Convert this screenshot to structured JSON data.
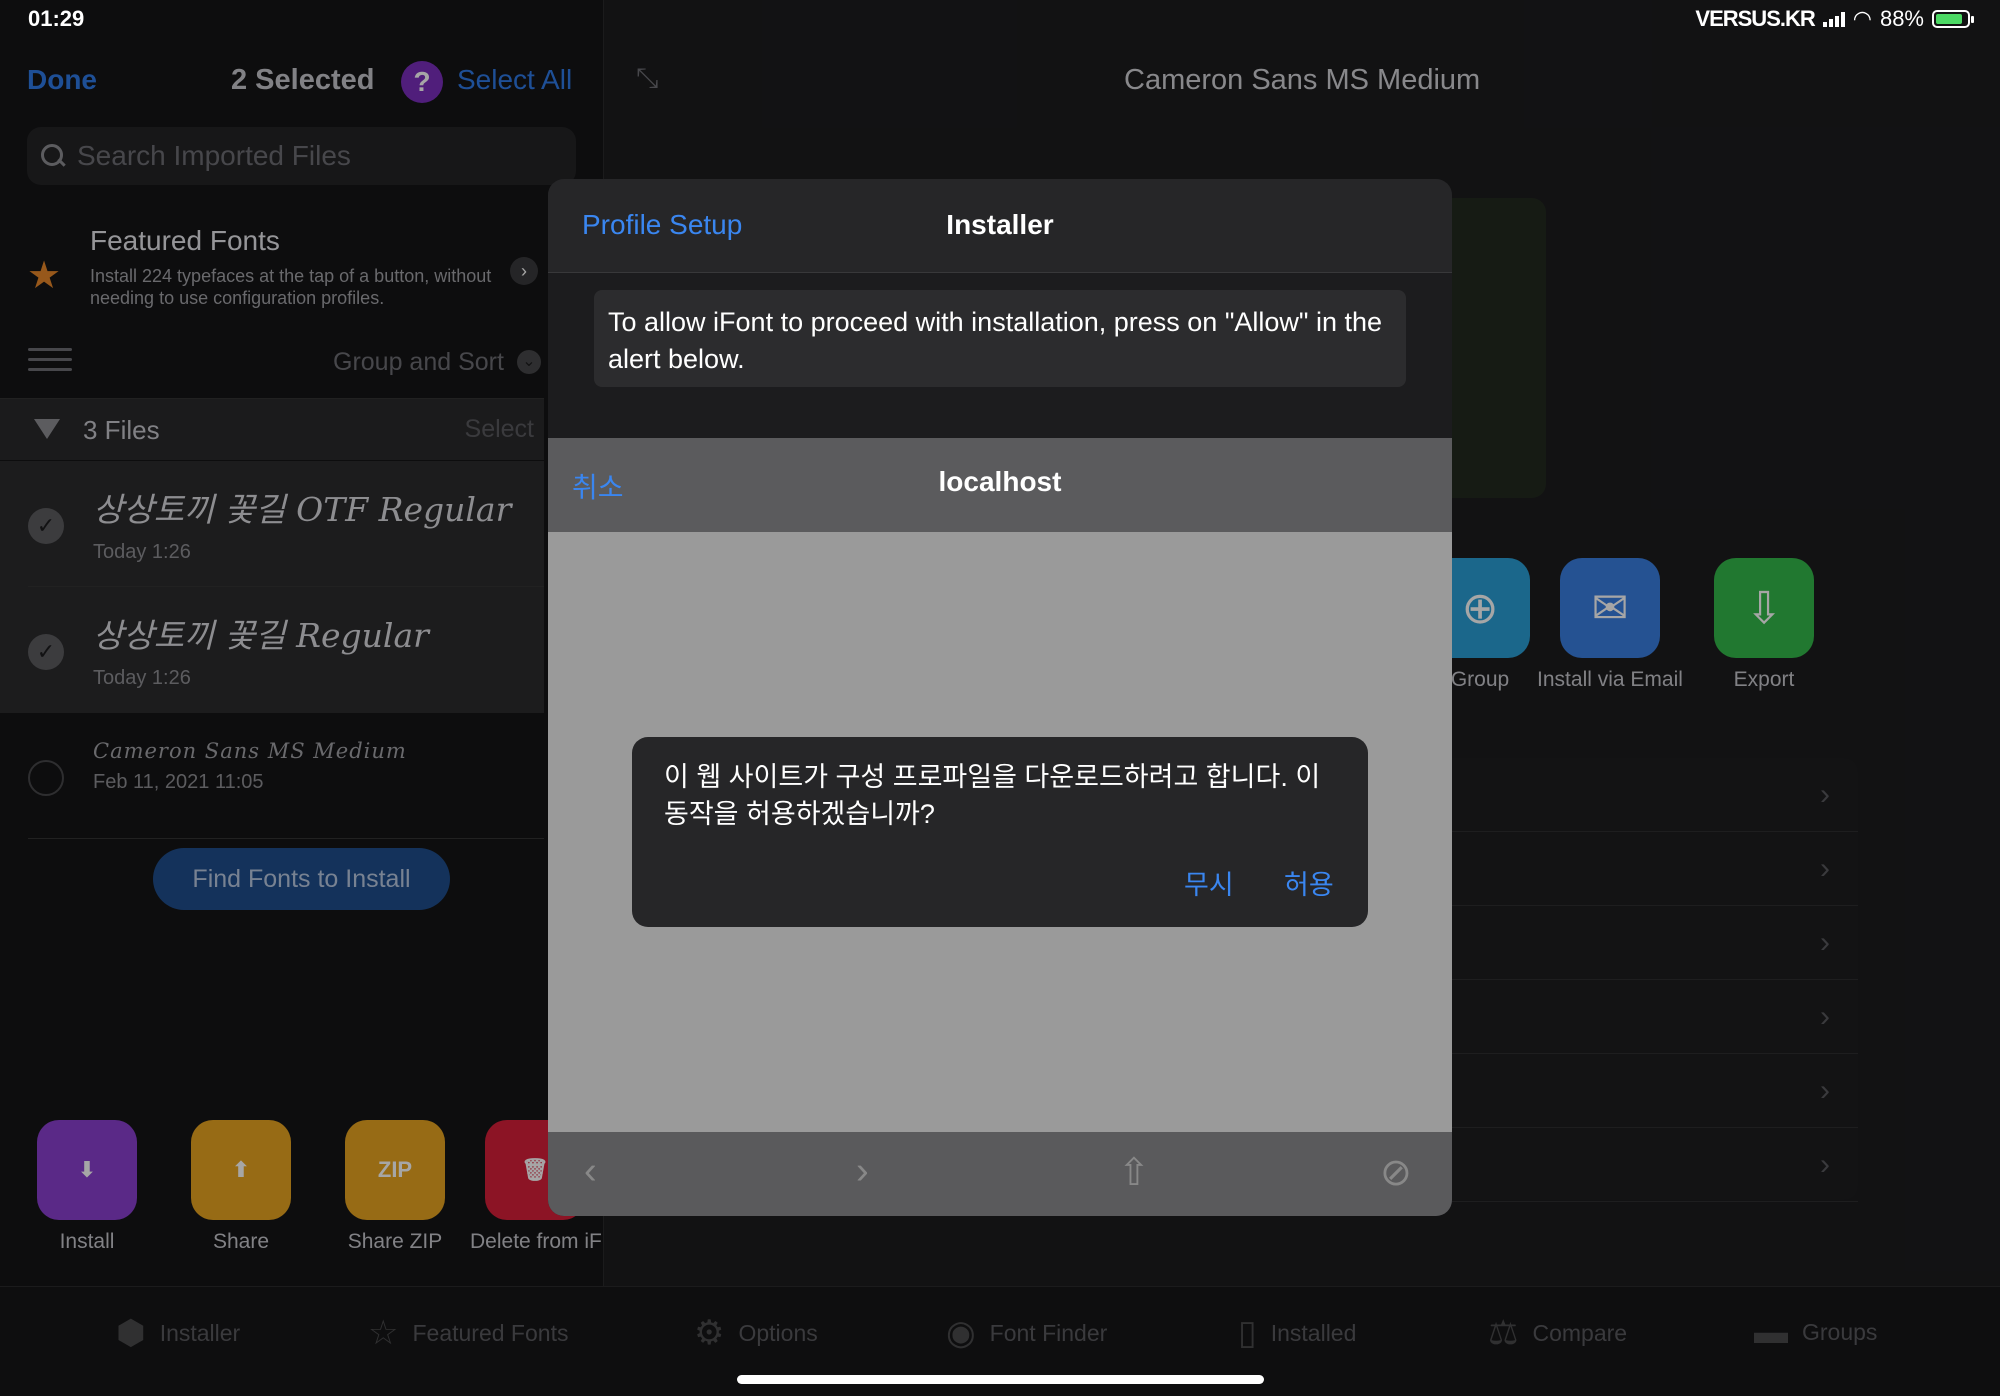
{
  "status": {
    "time": "01:29",
    "carrier": "VERSUS.KR",
    "battery": "88%"
  },
  "sidebar": {
    "done_label": "Done",
    "selected_label": "2 Selected",
    "select_all_label": "Select All",
    "search_placeholder": "Search Imported Files",
    "featured": {
      "title": "Featured Fonts",
      "description": "Install 224 typefaces at the tap of a button, without needing to use configuration profiles."
    },
    "group_sort_label": "Group and Sort",
    "section": {
      "title": "3 Files",
      "select_label": "Select"
    },
    "files": [
      {
        "name": "상상토끼 꽃길 OTF Regular",
        "date": "Today 1:26",
        "selected": true
      },
      {
        "name": "상상토끼 꽃길 Regular",
        "date": "Today 1:26",
        "selected": true
      },
      {
        "name": "Cameron Sans MS Medium",
        "date": "Feb 11, 2021 11:05",
        "selected": false
      }
    ],
    "find_fonts_label": "Find Fonts to Install",
    "actions": [
      {
        "label": "Install",
        "color": "#8a3fd0",
        "icon": "install-icon"
      },
      {
        "label": "Share",
        "color": "#e8a521",
        "icon": "share-icon"
      },
      {
        "label": "Share ZIP",
        "color": "#e8a521",
        "icon": "zip-icon"
      },
      {
        "label": "Delete from iF",
        "color": "#d81f3a",
        "icon": "trash-icon"
      }
    ]
  },
  "detail": {
    "title": "Cameron Sans MS Medium",
    "tiles": [
      {
        "label": "Group",
        "color": "#2a9fd6",
        "icon": "add-to-group-icon"
      },
      {
        "label": "Install via Email",
        "color": "#3a7ee0",
        "icon": "mail-icon"
      },
      {
        "label": "Export",
        "color": "#34b84a",
        "icon": "export-icon"
      }
    ]
  },
  "modal": {
    "back_label": "Profile Setup",
    "title": "Installer",
    "note": "To allow iFont to proceed with installation, press on \"Allow\" in the alert below.",
    "web": {
      "cancel_label": "취소",
      "host": "localhost"
    }
  },
  "alert": {
    "message": "이 웹 사이트가 구성 프로파일을 다운로드하려고 합니다. 이 동작을 허용하겠습니까?",
    "ignore_label": "무시",
    "allow_label": "허용"
  },
  "tabbar": {
    "tabs": [
      {
        "label": "Installer",
        "icon": "cube-icon"
      },
      {
        "label": "Featured Fonts",
        "icon": "star-icon"
      },
      {
        "label": "Options",
        "icon": "gear-icon"
      },
      {
        "label": "Font Finder",
        "icon": "magnifier-icon"
      },
      {
        "label": "Installed",
        "icon": "phone-icon"
      },
      {
        "label": "Compare",
        "icon": "scales-icon"
      },
      {
        "label": "Groups",
        "icon": "folder-icon"
      }
    ]
  }
}
